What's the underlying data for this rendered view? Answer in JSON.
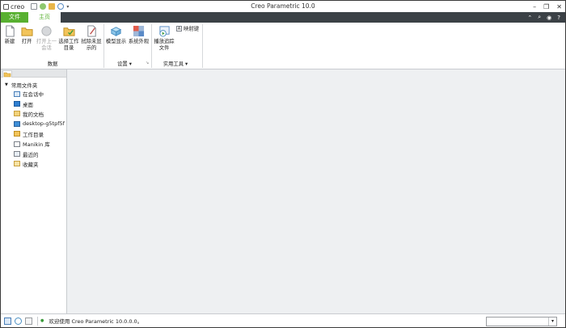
{
  "app": {
    "logo_text": "creo",
    "title": "Creo Parametric 10.0"
  },
  "tabs": {
    "file": "文件",
    "home": "主页"
  },
  "ribbon": {
    "new": "新建",
    "open": "打开",
    "open_last_line1": "打开上一",
    "open_last_line2": "会话",
    "select_wd_line1": "选择工作",
    "select_wd_line2": "目录",
    "erase_line1": "拭除未显",
    "erase_line2": "示的",
    "data_group": "数据",
    "model_display": "模型显示",
    "system_appearance": "系统外观",
    "settings_group": "设置",
    "playback_line1": "播放追踪",
    "playback_line2": "文件",
    "mapkeys": "映射键",
    "utilities_group": "实用工具"
  },
  "folder_panel": {
    "header": "常用文件夹",
    "items": [
      {
        "label": "在会话中",
        "icon": "session-icon"
      },
      {
        "label": "桌面",
        "icon": "desktop-icon"
      },
      {
        "label": "我的文档",
        "icon": "documents-icon"
      },
      {
        "label": "desktop-g5tpf5f",
        "icon": "computer-icon"
      },
      {
        "label": "工作目录",
        "icon": "working-dir-icon"
      },
      {
        "label": "Manikin 库",
        "icon": "manikin-icon"
      },
      {
        "label": "最近的",
        "icon": "recent-icon"
      },
      {
        "label": "收藏夹",
        "icon": "favorites-icon"
      }
    ]
  },
  "status": {
    "message": "欢迎使用 Creo Parametric 10.0.0.0。"
  },
  "colors": {
    "accent": "#58b031",
    "tabstrip": "#3b4146",
    "workspace": "#eef0f2"
  }
}
